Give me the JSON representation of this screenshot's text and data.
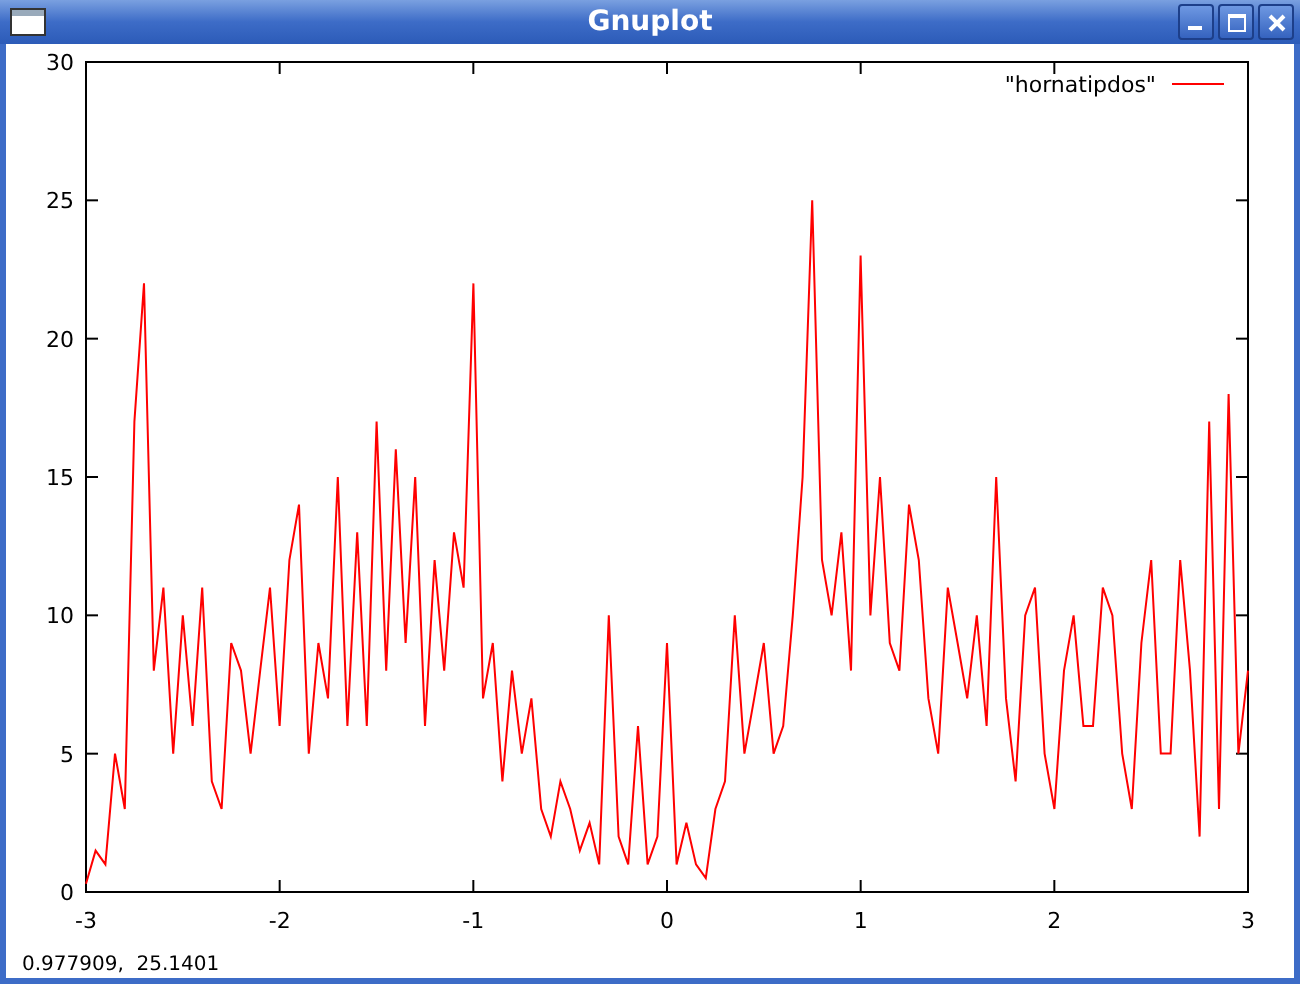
{
  "window": {
    "title": "Gnuplot"
  },
  "plot": {
    "chart_data": {
      "type": "line",
      "xlim": [
        -3,
        3
      ],
      "ylim": [
        0,
        30
      ],
      "xticks": [
        -3,
        -2,
        -1,
        0,
        1,
        2,
        3
      ],
      "yticks": [
        0,
        5,
        10,
        15,
        20,
        25,
        30
      ],
      "x": [
        -3,
        -2.95,
        -2.9,
        -2.85,
        -2.8,
        -2.75,
        -2.7,
        -2.65,
        -2.6,
        -2.55,
        -2.5,
        -2.45,
        -2.4,
        -2.35,
        -2.3,
        -2.25,
        -2.2,
        -2.15,
        -2.1,
        -2.05,
        -2,
        -1.95,
        -1.9,
        -1.85,
        -1.8,
        -1.75,
        -1.7,
        -1.65,
        -1.6,
        -1.55,
        -1.5,
        -1.45,
        -1.4,
        -1.35,
        -1.3,
        -1.25,
        -1.2,
        -1.15,
        -1.1,
        -1.05,
        -1,
        -0.95,
        -0.9,
        -0.85,
        -0.8,
        -0.75,
        -0.7,
        -0.65,
        -0.6,
        -0.55,
        -0.5,
        -0.45,
        -0.4,
        -0.35,
        -0.3,
        -0.25,
        -0.2,
        -0.15,
        -0.1,
        -0.05,
        0,
        0.05,
        0.1,
        0.15,
        0.2,
        0.25,
        0.3,
        0.35,
        0.4,
        0.45,
        0.5,
        0.55,
        0.6,
        0.65,
        0.7,
        0.75,
        0.8,
        0.85,
        0.9,
        0.95,
        1,
        1.05,
        1.1,
        1.15,
        1.2,
        1.25,
        1.3,
        1.35,
        1.4,
        1.45,
        1.5,
        1.55,
        1.6,
        1.65,
        1.7,
        1.75,
        1.8,
        1.85,
        1.9,
        1.95,
        2,
        2.05,
        2.1,
        2.15,
        2.2,
        2.25,
        2.3,
        2.35,
        2.4,
        2.45,
        2.5,
        2.55,
        2.6,
        2.65,
        2.7,
        2.75,
        2.8,
        2.85,
        2.9,
        2.95,
        3
      ],
      "series": [
        {
          "name": "\"hornatipdos\"",
          "color": "#ff0000",
          "values": [
            0.3,
            1.5,
            1,
            5,
            3,
            17,
            22,
            8,
            11,
            5,
            10,
            6,
            11,
            4,
            3,
            9,
            8,
            5,
            8,
            11,
            6,
            12,
            14,
            5,
            9,
            7,
            15,
            6,
            13,
            6,
            17,
            8,
            16,
            9,
            15,
            6,
            12,
            8,
            13,
            11,
            22,
            7,
            9,
            4,
            8,
            5,
            7,
            3,
            2,
            4,
            3,
            1.5,
            2.5,
            1,
            10,
            2,
            1,
            6,
            1,
            2,
            9,
            1,
            2.5,
            1,
            0.5,
            3,
            4,
            10,
            5,
            7,
            9,
            5,
            6,
            10,
            15,
            25,
            12,
            10,
            13,
            8,
            23,
            10,
            15,
            9,
            8,
            14,
            12,
            7,
            5,
            11,
            9,
            7,
            10,
            6,
            15,
            7,
            4,
            10,
            11,
            5,
            3,
            8,
            10,
            6,
            6,
            11,
            10,
            5,
            3,
            9,
            12,
            5,
            5,
            12,
            8,
            2,
            17,
            3,
            18,
            5,
            8
          ]
        }
      ]
    }
  },
  "status_bar": {
    "text": "0.977909,  25.1401"
  }
}
